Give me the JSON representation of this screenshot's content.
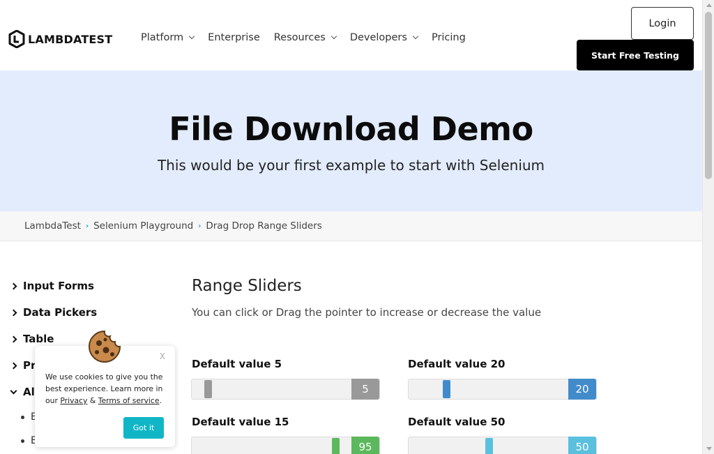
{
  "header": {
    "logo_text": "LAMBDATEST",
    "nav": [
      {
        "label": "Platform",
        "dropdown": true
      },
      {
        "label": "Enterprise",
        "dropdown": false
      },
      {
        "label": "Resources",
        "dropdown": true
      },
      {
        "label": "Developers",
        "dropdown": true
      },
      {
        "label": "Pricing",
        "dropdown": false
      }
    ],
    "login_label": "Login",
    "start_label": "Start Free Testing"
  },
  "hero": {
    "title": "File Download Demo",
    "subtitle": "This would be your first example to start with Selenium"
  },
  "breadcrumb": [
    "LambdaTest",
    "Selenium Playground",
    "Drag Drop Range Sliders"
  ],
  "sidebar": {
    "items": [
      {
        "label": "Input Forms",
        "expanded": false
      },
      {
        "label": "Data Pickers",
        "expanded": false
      },
      {
        "label": "Table",
        "expanded": false
      },
      {
        "label": "Pr",
        "expanded": false
      },
      {
        "label": "Al",
        "expanded": true
      }
    ],
    "sub_items": [
      "B",
      "B"
    ]
  },
  "main": {
    "title": "Range Sliders",
    "description": "You can click or Drag the pointer to increase or decrease the value"
  },
  "sliders": [
    {
      "label": "Default value 5",
      "value": "5",
      "position": 0.05,
      "color": "#999999"
    },
    {
      "label": "Default value 20",
      "value": "20",
      "position": 0.2,
      "color": "#428bca"
    },
    {
      "label": "Default value 15",
      "value": "95",
      "position": 0.95,
      "color": "#5cb85c"
    },
    {
      "label": "Default value 50",
      "value": "50",
      "position": 0.5,
      "color": "#5bc0de"
    }
  ],
  "cookie": {
    "close": "X",
    "text_before": "We use cookies to give you the best experience. Learn more in our ",
    "privacy": "Privacy",
    "amp": " & ",
    "terms": "Terms of service",
    "period": ".",
    "button": "Got it"
  }
}
